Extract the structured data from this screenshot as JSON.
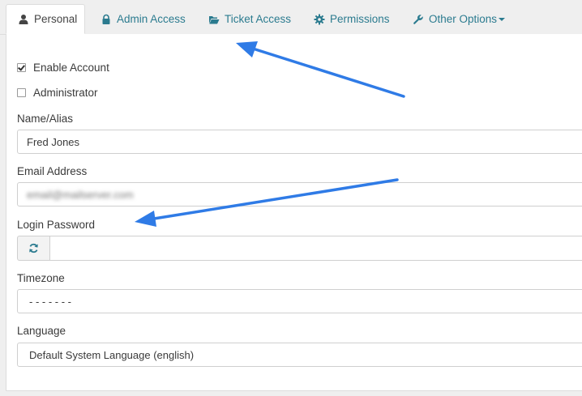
{
  "tabs": [
    {
      "label": "Personal",
      "icon": "user-icon",
      "active": true
    },
    {
      "label": "Admin Access",
      "icon": "lock-icon",
      "active": false
    },
    {
      "label": "Ticket Access",
      "icon": "folder-open-icon",
      "active": false
    },
    {
      "label": "Permissions",
      "icon": "gear-icon",
      "active": false
    },
    {
      "label": "Other Options",
      "icon": "wrench-icon",
      "active": false,
      "dropdown": true
    }
  ],
  "form": {
    "enable_account": {
      "label": "Enable Account",
      "checked": true
    },
    "administrator": {
      "label": "Administrator",
      "checked": false
    },
    "name": {
      "label": "Name/Alias",
      "value": "Fred Jones"
    },
    "email": {
      "label": "Email Address",
      "value": "email@mailserver.com",
      "redacted": true
    },
    "password": {
      "label": "Login Password",
      "value": "",
      "button_icon": "refresh-icon"
    },
    "timezone": {
      "label": "Timezone",
      "value": "- - - - - - -"
    },
    "language": {
      "label": "Language",
      "value": "Default System Language (english)"
    }
  },
  "colors": {
    "tab_link": "#2b7b8f",
    "annotation_arrow": "#2f7be6"
  }
}
